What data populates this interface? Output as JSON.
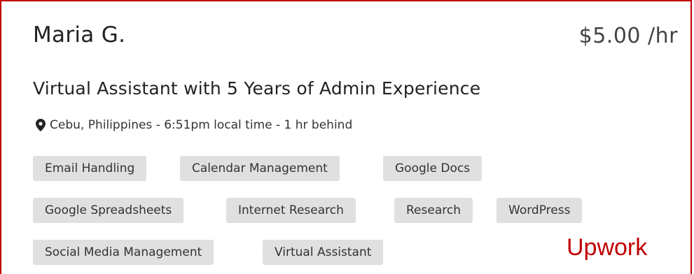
{
  "profile": {
    "name": "Maria G.",
    "rate": "$5.00 /hr",
    "title": "Virtual Assistant with 5 Years of Admin Experience",
    "location_icon": "map-pin-icon",
    "location": "Cebu, Philippines - 6:51pm local time - 1 hr behind"
  },
  "skills": [
    "Email Handling",
    "Calendar Management",
    "Google Docs",
    "Google Spreadsheets",
    "Internet Research",
    "Research",
    "WordPress",
    "Social Media Management",
    "Virtual Assistant"
  ],
  "watermark": "Upwork",
  "colors": {
    "border": "#c00000",
    "tag_background": "#e0e0e0",
    "watermark": "#c00000"
  }
}
